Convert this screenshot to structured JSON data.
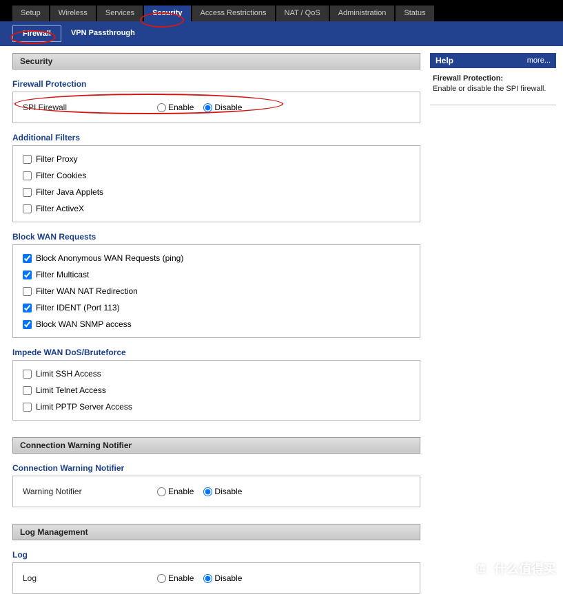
{
  "main_tabs": [
    "Setup",
    "Wireless",
    "Services",
    "Security",
    "Access Restrictions",
    "NAT / QoS",
    "Administration",
    "Status"
  ],
  "main_tab_active": 3,
  "sub_tabs": [
    "Firewall",
    "VPN Passthrough"
  ],
  "sub_tab_active": 0,
  "groups": {
    "security_header": "Security",
    "conn_warn_header": "Connection Warning Notifier",
    "log_header": "Log Management"
  },
  "firewall": {
    "section": "Firewall Protection",
    "label": "SPI Firewall",
    "enable": "Enable",
    "disable": "Disable",
    "value": "disable"
  },
  "filters": {
    "section": "Additional Filters",
    "items": [
      {
        "label": "Filter Proxy",
        "checked": false
      },
      {
        "label": "Filter Cookies",
        "checked": false
      },
      {
        "label": "Filter Java Applets",
        "checked": false
      },
      {
        "label": "Filter ActiveX",
        "checked": false
      }
    ]
  },
  "block_wan": {
    "section": "Block WAN Requests",
    "items": [
      {
        "label": "Block Anonymous WAN Requests (ping)",
        "checked": true
      },
      {
        "label": "Filter Multicast",
        "checked": true
      },
      {
        "label": "Filter WAN NAT Redirection",
        "checked": false
      },
      {
        "label": "Filter IDENT (Port 113)",
        "checked": true
      },
      {
        "label": "Block WAN SNMP access",
        "checked": true
      }
    ]
  },
  "impede": {
    "section": "Impede WAN DoS/Bruteforce",
    "items": [
      {
        "label": "Limit SSH Access",
        "checked": false
      },
      {
        "label": "Limit Telnet Access",
        "checked": false
      },
      {
        "label": "Limit PPTP Server Access",
        "checked": false
      }
    ]
  },
  "conn_warn": {
    "section": "Connection Warning Notifier",
    "label": "Warning Notifier",
    "enable": "Enable",
    "disable": "Disable",
    "value": "disable"
  },
  "log": {
    "section": "Log",
    "label": "Log",
    "enable": "Enable",
    "disable": "Disable",
    "value": "disable"
  },
  "help": {
    "title": "Help",
    "more": "more...",
    "heading": "Firewall Protection:",
    "text": "Enable or disable the SPI firewall."
  },
  "watermark": "什么值得买"
}
